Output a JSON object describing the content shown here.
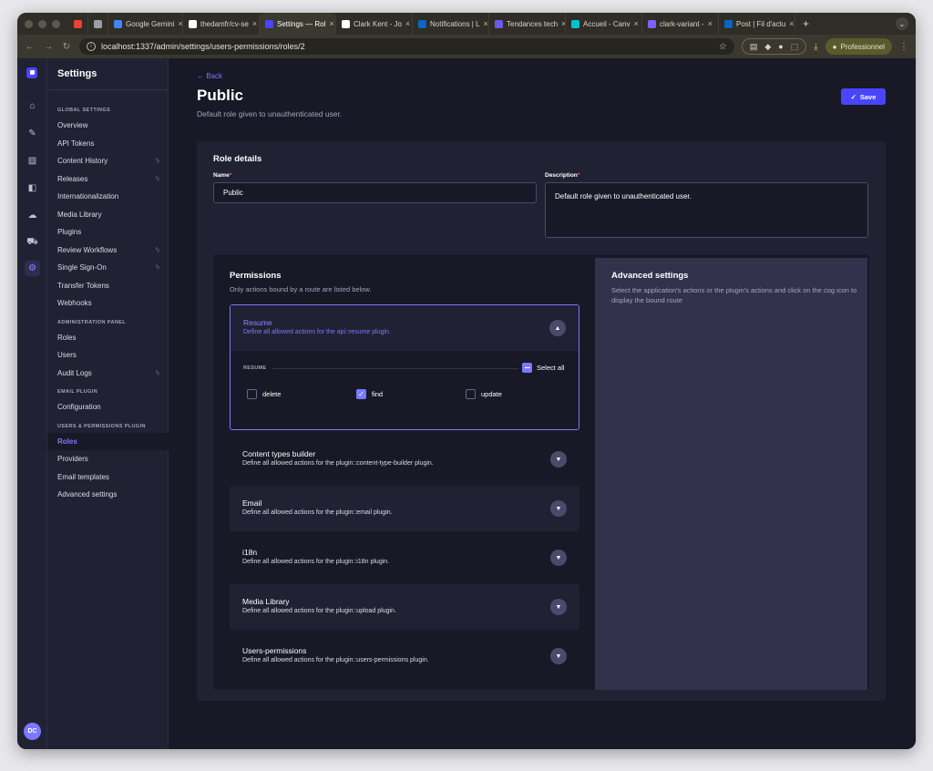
{
  "browser": {
    "tabs": [
      {
        "label": "",
        "color": "#ea4335",
        "active": false
      },
      {
        "label": "",
        "color": "#9aa0a6",
        "active": false
      },
      {
        "label": "Google Gemini",
        "color": "#4285f4",
        "active": false
      },
      {
        "label": "thedamfr/cv-se",
        "color": "#ffffff",
        "active": false
      },
      {
        "label": "Settings — Rol",
        "color": "#4945ff",
        "active": true
      },
      {
        "label": "Clark Kent - Jo",
        "color": "#ffffff",
        "active": false
      },
      {
        "label": "Notifications | L",
        "color": "#0a66c2",
        "active": false
      },
      {
        "label": "Tendances tech",
        "color": "#6b5ce7",
        "active": false
      },
      {
        "label": "Accueil - Canv",
        "color": "#00c4cc",
        "active": false
      },
      {
        "label": "clark-variant -",
        "color": "#7b61ff",
        "active": false
      },
      {
        "label": "Post | Fil d'actu",
        "color": "#0a66c2",
        "active": false
      }
    ],
    "url": "localhost:1337/admin/settings/users-permissions/roles/2",
    "profile": "Professionnel"
  },
  "rail": {
    "avatar": "DC"
  },
  "sidenav": {
    "title": "Settings",
    "sections": [
      {
        "label": "GLOBAL SETTINGS",
        "items": [
          {
            "label": "Overview",
            "bolt": false,
            "active": false
          },
          {
            "label": "API Tokens",
            "bolt": false,
            "active": false
          },
          {
            "label": "Content History",
            "bolt": true,
            "active": false
          },
          {
            "label": "Releases",
            "bolt": true,
            "active": false
          },
          {
            "label": "Internationalization",
            "bolt": false,
            "active": false
          },
          {
            "label": "Media Library",
            "bolt": false,
            "active": false
          },
          {
            "label": "Plugins",
            "bolt": false,
            "active": false
          },
          {
            "label": "Review Workflows",
            "bolt": true,
            "active": false
          },
          {
            "label": "Single Sign-On",
            "bolt": true,
            "active": false
          },
          {
            "label": "Transfer Tokens",
            "bolt": false,
            "active": false
          },
          {
            "label": "Webhooks",
            "bolt": false,
            "active": false
          }
        ]
      },
      {
        "label": "ADMINISTRATION PANEL",
        "items": [
          {
            "label": "Roles",
            "bolt": false,
            "active": false
          },
          {
            "label": "Users",
            "bolt": false,
            "active": false
          },
          {
            "label": "Audit Logs",
            "bolt": true,
            "active": false
          }
        ]
      },
      {
        "label": "EMAIL PLUGIN",
        "items": [
          {
            "label": "Configuration",
            "bolt": false,
            "active": false
          }
        ]
      },
      {
        "label": "USERS & PERMISSIONS PLUGIN",
        "items": [
          {
            "label": "Roles",
            "bolt": false,
            "active": true
          },
          {
            "label": "Providers",
            "bolt": false,
            "active": false
          },
          {
            "label": "Email templates",
            "bolt": false,
            "active": false
          },
          {
            "label": "Advanced settings",
            "bolt": false,
            "active": false
          }
        ]
      }
    ]
  },
  "header": {
    "back": "Back",
    "title": "Public",
    "subtitle": "Default role given to unauthenticated user.",
    "save": "Save"
  },
  "role_details": {
    "title": "Role details",
    "name_label": "Name",
    "name_value": "Public",
    "description_label": "Description",
    "description_value": "Default role given to unauthenticated user."
  },
  "permissions": {
    "title": "Permissions",
    "subtitle": "Only actions bound by a route are listed below.",
    "open": {
      "name": "Resume",
      "desc": "Define all allowed actions for the api::resume plugin.",
      "group_label": "RESUME",
      "select_all": "Select all",
      "actions": [
        {
          "label": "delete",
          "checked": false
        },
        {
          "label": "find",
          "checked": true
        },
        {
          "label": "update",
          "checked": false
        }
      ]
    },
    "closed": [
      {
        "name": "Content types builder",
        "desc": "Define all allowed actions for the plugin::content-type-builder plugin."
      },
      {
        "name": "Email",
        "desc": "Define all allowed actions for the plugin::email plugin."
      },
      {
        "name": "i18n",
        "desc": "Define all allowed actions for the plugin::i18n plugin."
      },
      {
        "name": "Media Library",
        "desc": "Define all allowed actions for the plugin::upload plugin."
      },
      {
        "name": "Users-permissions",
        "desc": "Define all allowed actions for the plugin::users-permissions plugin."
      }
    ]
  },
  "advanced": {
    "title": "Advanced settings",
    "desc": "Select the application's actions or the plugin's actions and click on the cog icon to display the bound route"
  }
}
